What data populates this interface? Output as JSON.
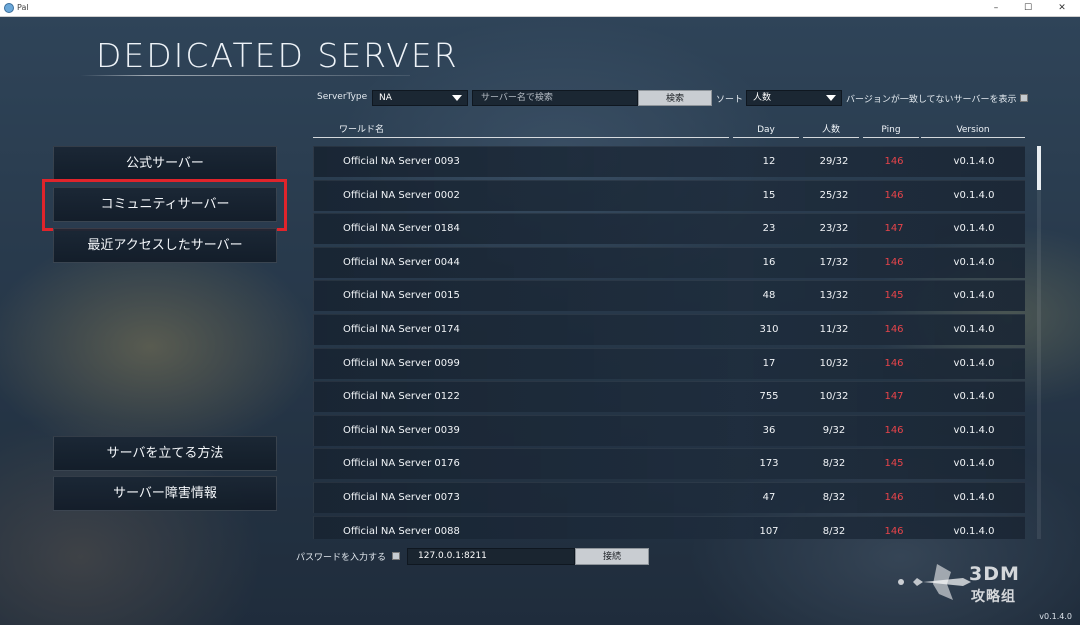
{
  "window": {
    "title": "Pal",
    "minimize": "–",
    "maximize": "☐",
    "close": "✕"
  },
  "page": {
    "title": "DEDICATED SERVER"
  },
  "filters": {
    "server_type_label": "ServerType",
    "server_type_value": "NA",
    "search_placeholder": "サーバー名で検索",
    "search_button": "検索",
    "sort_label": "ソート",
    "sort_value": "人数",
    "version_mismatch_label": "バージョンが一致してないサーバーを表示",
    "version_mismatch_checked": false
  },
  "table": {
    "columns": {
      "world": "ワールド名",
      "day": "Day",
      "players": "人数",
      "ping": "Ping",
      "version": "Version"
    },
    "ping_color": "#e8444a",
    "rows": [
      {
        "name": "Official NA Server 0093",
        "day": "12",
        "players": "29/32",
        "ping": "146",
        "version": "v0.1.4.0"
      },
      {
        "name": "Official NA Server 0002",
        "day": "15",
        "players": "25/32",
        "ping": "146",
        "version": "v0.1.4.0"
      },
      {
        "name": "Official NA Server 0184",
        "day": "23",
        "players": "23/32",
        "ping": "147",
        "version": "v0.1.4.0"
      },
      {
        "name": "Official NA Server 0044",
        "day": "16",
        "players": "17/32",
        "ping": "146",
        "version": "v0.1.4.0"
      },
      {
        "name": "Official NA Server 0015",
        "day": "48",
        "players": "13/32",
        "ping": "145",
        "version": "v0.1.4.0"
      },
      {
        "name": "Official NA Server 0174",
        "day": "310",
        "players": "11/32",
        "ping": "146",
        "version": "v0.1.4.0"
      },
      {
        "name": "Official NA Server 0099",
        "day": "17",
        "players": "10/32",
        "ping": "146",
        "version": "v0.1.4.0"
      },
      {
        "name": "Official NA Server 0122",
        "day": "755",
        "players": "10/32",
        "ping": "147",
        "version": "v0.1.4.0"
      },
      {
        "name": "Official NA Server 0039",
        "day": "36",
        "players": "9/32",
        "ping": "146",
        "version": "v0.1.4.0"
      },
      {
        "name": "Official NA Server 0176",
        "day": "173",
        "players": "8/32",
        "ping": "145",
        "version": "v0.1.4.0"
      },
      {
        "name": "Official NA Server 0073",
        "day": "47",
        "players": "8/32",
        "ping": "146",
        "version": "v0.1.4.0"
      },
      {
        "name": "Official NA Server 0088",
        "day": "107",
        "players": "8/32",
        "ping": "146",
        "version": "v0.1.4.0"
      }
    ]
  },
  "sidebar": {
    "official": "公式サーバー",
    "community": "コミュニティサーバー",
    "recent": "最近アクセスしたサーバー",
    "how_to_host": "サーバを立てる方法",
    "outage_info": "サーバー障害情報",
    "highlight_color": "#e0242b"
  },
  "password": {
    "label": "パスワードを入力する",
    "checked": false,
    "address": "127.0.0.1:8211",
    "connect_button": "接続"
  },
  "footer": {
    "version": "v0.1.4.0"
  },
  "watermark": {
    "line1": "3DM",
    "line2": "攻略组"
  }
}
